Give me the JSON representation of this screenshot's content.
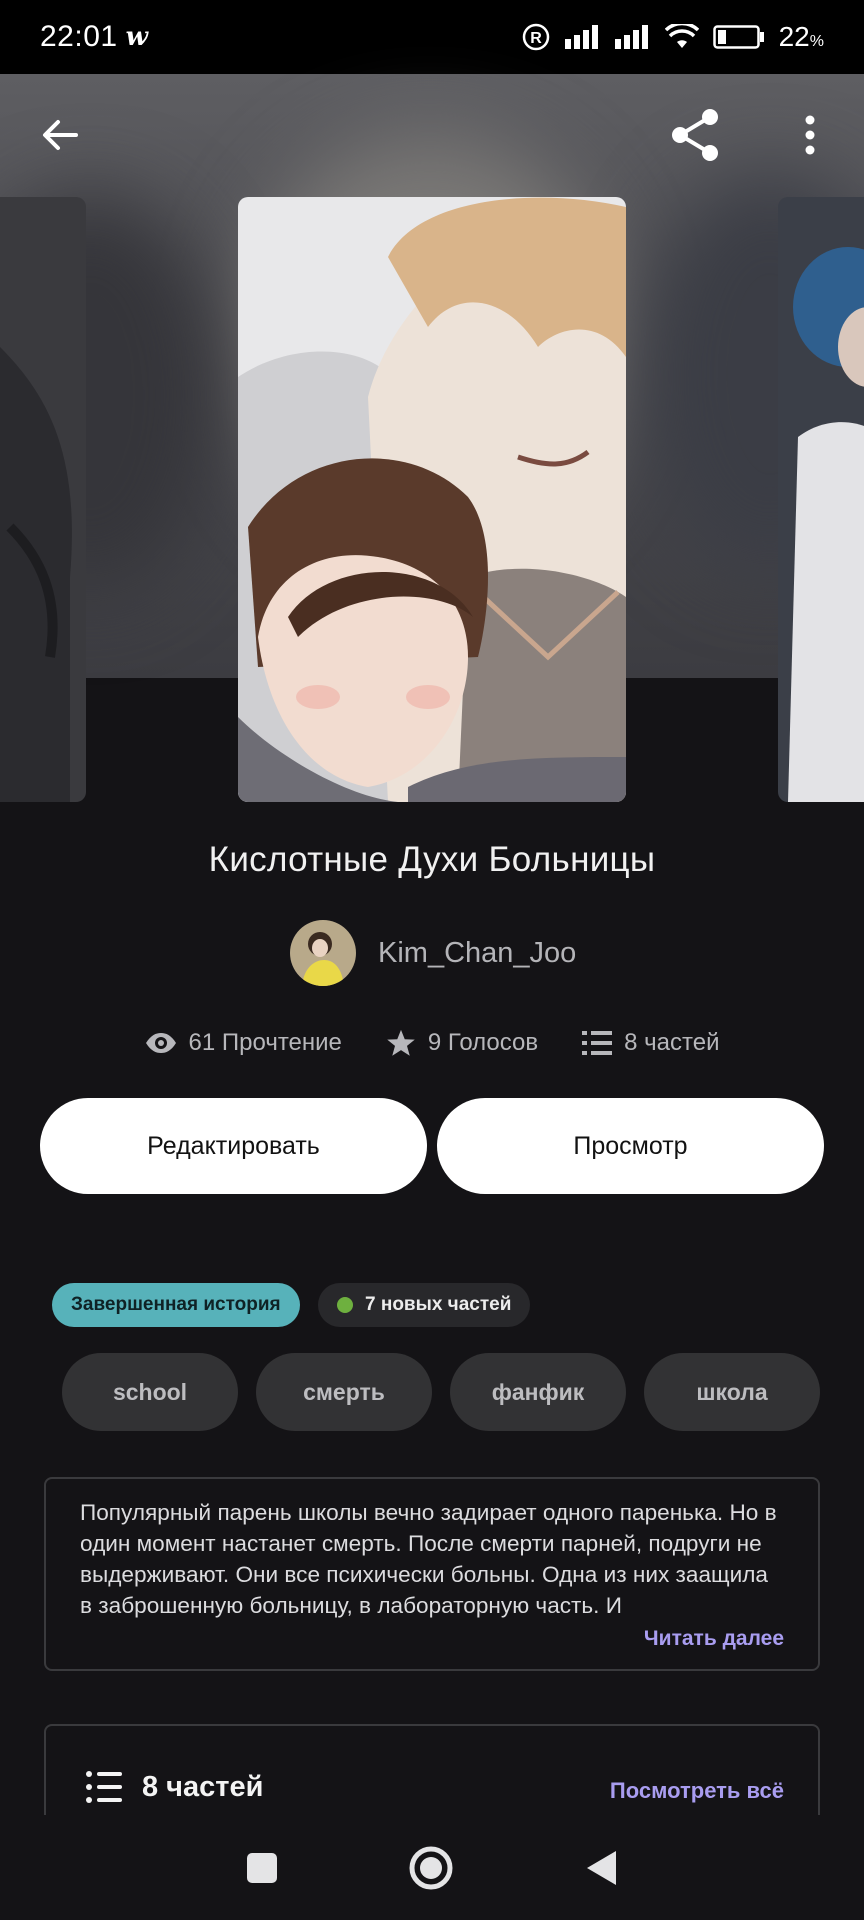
{
  "status": {
    "time": "22:01",
    "app_glyph": "w",
    "battery_value": "22",
    "battery_unit": "%",
    "battery_level": 0.22
  },
  "topbar": {
    "back_icon": "arrow-left-icon",
    "share_icon": "share-icon",
    "menu_icon": "kebab-menu-icon"
  },
  "story": {
    "title": "Кислотные Духи Больницы",
    "author": "Kim_Chan_Joo",
    "stats": {
      "reads": "61 Прочтение",
      "votes": "9 Голосов",
      "parts": "8 частей"
    }
  },
  "actions": {
    "edit_label": "Редактировать",
    "view_label": "Просмотр"
  },
  "badges": {
    "complete": "Завершенная история",
    "new_parts": "7 новых частей"
  },
  "tags": [
    "school",
    "смерть",
    "фанфик",
    "школа"
  ],
  "description": {
    "text": "Популярный парень школы вечно задирает одного паренька. Но в один момент настанет смерть. После смерти парней, подруги не выдерживают. Они все психически больны. Одна из них заащила в заброшенную больницу, в лабораторную часть. И",
    "read_more": "Читать далее"
  },
  "parts_section": {
    "title": "8 частей",
    "see_all": "Посмотреть всё"
  },
  "colors": {
    "accent": "#a99df0",
    "complete_badge": "#57b2ba",
    "new_dot": "#6eb03f",
    "background": "#141316"
  }
}
